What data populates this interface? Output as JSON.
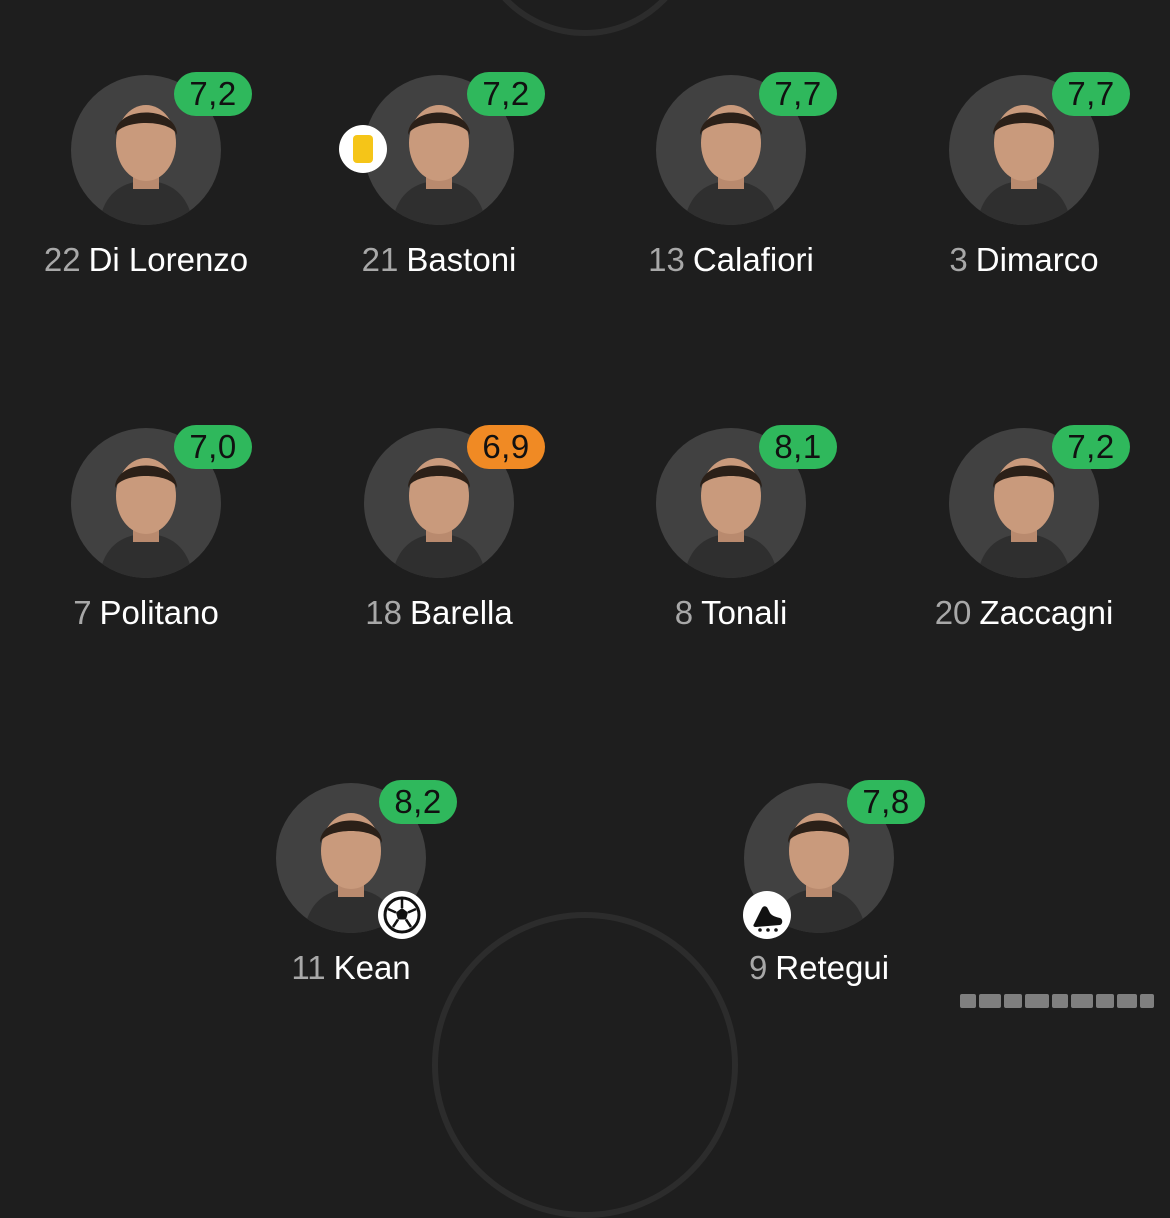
{
  "lineup": {
    "defenders": [
      {
        "number": "22",
        "name": "Di Lorenzo",
        "rating": "7,2",
        "rating_color": "#2fb85c"
      },
      {
        "number": "21",
        "name": "Bastoni",
        "rating": "7,2",
        "rating_color": "#2fb85c",
        "event": "yellow-card"
      },
      {
        "number": "13",
        "name": "Calafiori",
        "rating": "7,7",
        "rating_color": "#2fb85c"
      },
      {
        "number": "3",
        "name": "Dimarco",
        "rating": "7,7",
        "rating_color": "#2fb85c"
      }
    ],
    "midfielders": [
      {
        "number": "7",
        "name": "Politano",
        "rating": "7,0",
        "rating_color": "#2fb85c"
      },
      {
        "number": "18",
        "name": "Barella",
        "rating": "6,9",
        "rating_color": "#f08a24"
      },
      {
        "number": "8",
        "name": "Tonali",
        "rating": "8,1",
        "rating_color": "#2fb85c"
      },
      {
        "number": "20",
        "name": "Zaccagni",
        "rating": "7,2",
        "rating_color": "#2fb85c"
      }
    ],
    "forwards": [
      {
        "number": "11",
        "name": "Kean",
        "rating": "8,2",
        "rating_color": "#2fb85c",
        "event": "goal-ball-icon"
      },
      {
        "number": "9",
        "name": "Retegui",
        "rating": "7,8",
        "rating_color": "#2fb85c",
        "event": "assist-boot-icon"
      }
    ]
  },
  "colors": {
    "background": "#1e1e1e",
    "avatar_bg": "#414141",
    "rating_good": "#2fb85c",
    "rating_average": "#f08a24",
    "yellow_card": "#f5c518",
    "number_text": "#a8a8a8",
    "name_text": "#ffffff"
  }
}
